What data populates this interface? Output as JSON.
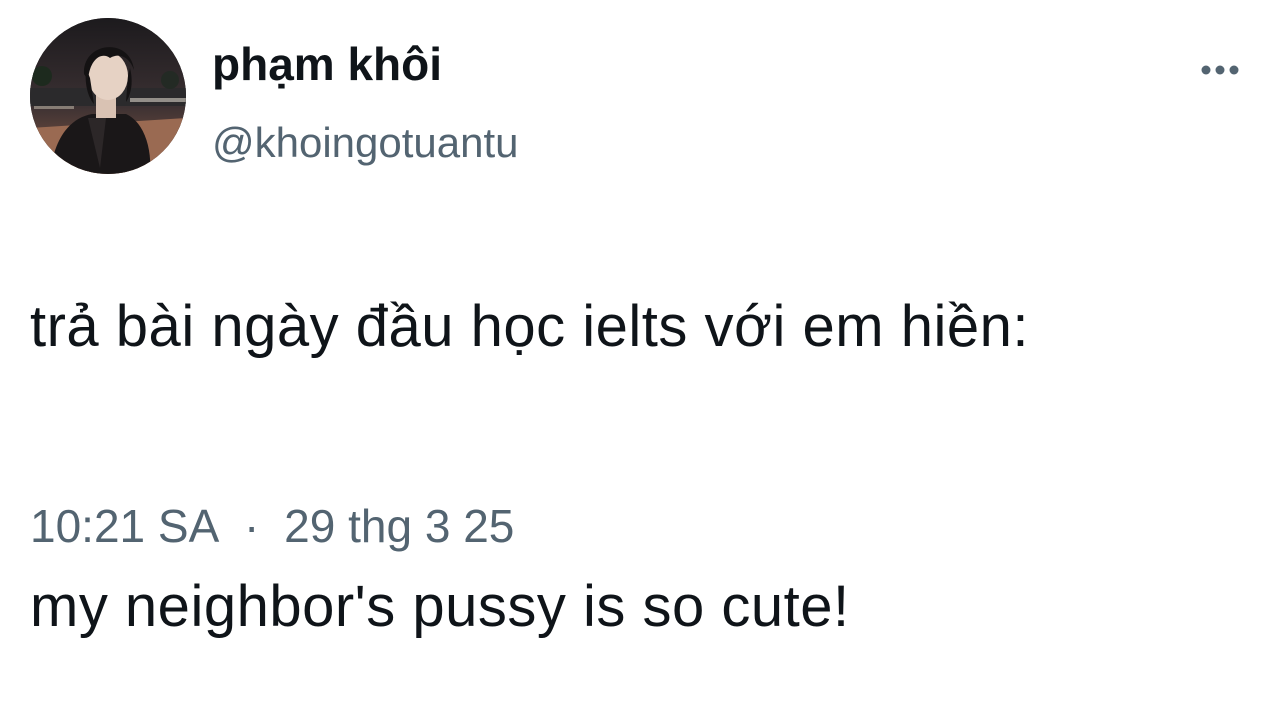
{
  "tweet": {
    "author": {
      "display_name": "phạm khôi",
      "handle": "@khoingotuantu",
      "avatar_icon": "profile-photo"
    },
    "more_icon": "more-horizontal-icon",
    "text_line_1": "trả bài ngày đầu học ielts với em hiền:",
    "text_line_2": "my neighbor's pussy is so cute!",
    "time": "10:21 SA",
    "separator": "·",
    "date": "29 thg 3 25"
  },
  "colors": {
    "primary_text": "#0f1419",
    "secondary_text": "#536471",
    "background": "#ffffff"
  }
}
